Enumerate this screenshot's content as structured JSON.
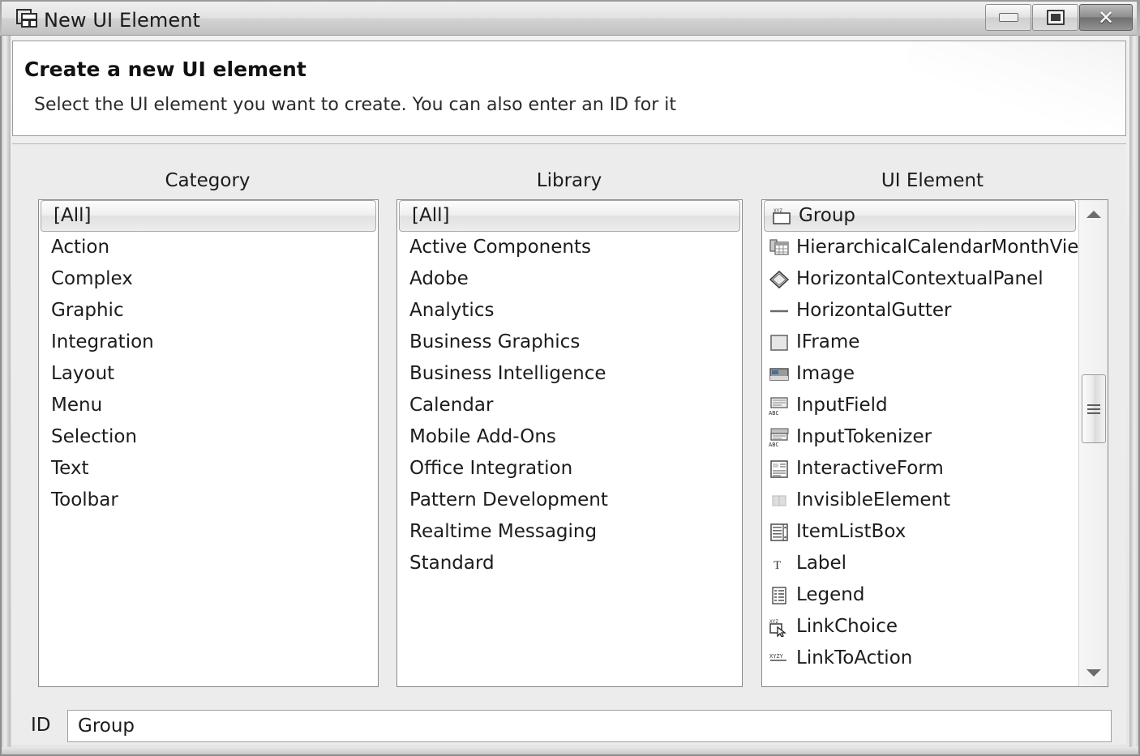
{
  "window": {
    "title": "New UI Element",
    "icon": "ui-element-icon",
    "buttons": {
      "minimize": "Minimize",
      "maximize": "Restore",
      "close": "Close"
    }
  },
  "header": {
    "title": "Create a new UI element",
    "subtitle": "Select the UI element you want to create. You can also enter an ID for it"
  },
  "columns": {
    "category_label": "Category",
    "library_label": "Library",
    "element_label": "UI Element"
  },
  "category": {
    "selected": "[All]",
    "items": [
      {
        "label": "[All]",
        "selected": true
      },
      {
        "label": "Action",
        "selected": false
      },
      {
        "label": "Complex",
        "selected": false
      },
      {
        "label": "Graphic",
        "selected": false
      },
      {
        "label": "Integration",
        "selected": false
      },
      {
        "label": "Layout",
        "selected": false
      },
      {
        "label": "Menu",
        "selected": false
      },
      {
        "label": "Selection",
        "selected": false
      },
      {
        "label": "Text",
        "selected": false
      },
      {
        "label": "Toolbar",
        "selected": false
      }
    ]
  },
  "library": {
    "selected": "[All]",
    "items": [
      {
        "label": "[All]",
        "selected": true
      },
      {
        "label": "Active Components",
        "selected": false
      },
      {
        "label": "Adobe",
        "selected": false
      },
      {
        "label": "Analytics",
        "selected": false
      },
      {
        "label": "Business Graphics",
        "selected": false
      },
      {
        "label": "Business Intelligence",
        "selected": false
      },
      {
        "label": "Calendar",
        "selected": false
      },
      {
        "label": "Mobile Add-Ons",
        "selected": false
      },
      {
        "label": "Office Integration",
        "selected": false
      },
      {
        "label": "Pattern Development",
        "selected": false
      },
      {
        "label": "Realtime Messaging",
        "selected": false
      },
      {
        "label": "Standard",
        "selected": false
      }
    ]
  },
  "ui_element": {
    "selected": "Group",
    "items": [
      {
        "label": "Group",
        "icon": "group-icon",
        "selected": true
      },
      {
        "label": "HierarchicalCalendarMonthView",
        "icon": "calendar-grid-icon",
        "selected": false
      },
      {
        "label": "HorizontalContextualPanel",
        "icon": "diamond-panel-icon",
        "selected": false
      },
      {
        "label": "HorizontalGutter",
        "icon": "horizontal-line-icon",
        "selected": false
      },
      {
        "label": "IFrame",
        "icon": "frame-box-icon",
        "selected": false
      },
      {
        "label": "Image",
        "icon": "image-icon",
        "selected": false
      },
      {
        "label": "InputField",
        "icon": "input-field-icon",
        "selected": false
      },
      {
        "label": "InputTokenizer",
        "icon": "input-tokenizer-icon",
        "selected": false
      },
      {
        "label": "InteractiveForm",
        "icon": "interactive-form-icon",
        "selected": false
      },
      {
        "label": "InvisibleElement",
        "icon": "invisible-element-icon",
        "selected": false
      },
      {
        "label": "ItemListBox",
        "icon": "item-list-box-icon",
        "selected": false
      },
      {
        "label": "Label",
        "icon": "text-label-icon",
        "selected": false
      },
      {
        "label": "Legend",
        "icon": "legend-icon",
        "selected": false
      },
      {
        "label": "LinkChoice",
        "icon": "link-choice-icon",
        "selected": false
      },
      {
        "label": "LinkToAction",
        "icon": "link-to-action-icon",
        "selected": false
      }
    ],
    "scrollbar": {
      "up_arrow": "scroll-up",
      "down_arrow": "scroll-down"
    }
  },
  "id_row": {
    "label": "ID",
    "value": "Group",
    "placeholder": ""
  },
  "colors": {
    "dialog_bg": "#ececec",
    "panel_white": "#ffffff",
    "border": "#8a8a8a",
    "text": "#1c1c1c",
    "titlebar_top": "#f0efef",
    "titlebar_bottom": "#c3c2c2"
  }
}
